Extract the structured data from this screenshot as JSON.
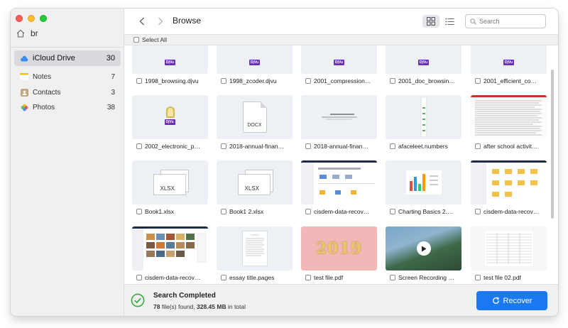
{
  "sidebar": {
    "breadcrumb": "br",
    "items": [
      {
        "label": "iCloud Drive",
        "count": "30"
      },
      {
        "label": "Notes",
        "count": "7"
      },
      {
        "label": "Contacts",
        "count": "3"
      },
      {
        "label": "Photos",
        "count": "38"
      }
    ]
  },
  "toolbar": {
    "title": "Browse",
    "search_placeholder": "Search"
  },
  "selection": {
    "select_all_label": "Select All"
  },
  "files": {
    "row0": [
      "1998_browsing.djvu",
      "1998_zcoder.djvu",
      "2001_compression…",
      "2001_doc_browsin…",
      "2001_efficient_co…"
    ],
    "row1": [
      "2002_electronic_p…",
      "2018-annual-finan…",
      "2018-annual-finan…",
      "afaceleet.numbers",
      "after school activit…"
    ],
    "row2": [
      "Book1.xlsx",
      "Book1 2.xlsx",
      "cisdem-data-recov…",
      "Charting Basics 2.…",
      "cisdem-data-recov…"
    ],
    "row3": [
      "cisdem-data-recov…",
      "essay title.pages",
      "test file.pdf",
      "Screen Recording …",
      "test file 02.pdf"
    ]
  },
  "thumb_text": {
    "djvu": "DjVu",
    "docx": "DOCX",
    "xlsx": "XLSX",
    "year": "2019"
  },
  "status": {
    "title": "Search Completed",
    "file_count": "78",
    "files_found_text": "file(s) found,",
    "size": "328.45 MB",
    "size_suffix": "in total",
    "recover_label": "Recover"
  },
  "colors": {
    "accent": "#1a78f2",
    "success": "#3aa83a",
    "djvu_badge": "#6a2fb6"
  }
}
